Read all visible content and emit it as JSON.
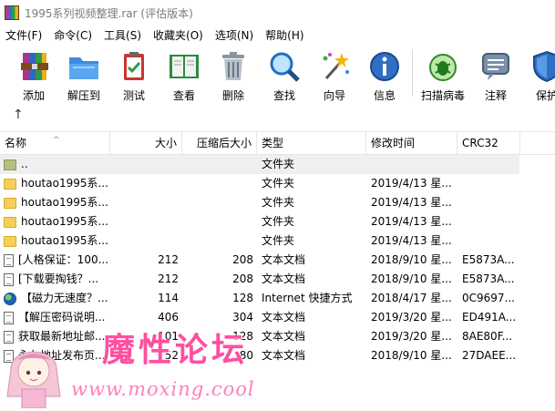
{
  "window": {
    "title": "1995系列视频整理.rar (评估版本)"
  },
  "menu": [
    "文件(F)",
    "命令(C)",
    "工具(S)",
    "收藏夹(O)",
    "选项(N)",
    "帮助(H)"
  ],
  "toolbar": [
    {
      "label": "添加",
      "icon": "add-archive-icon"
    },
    {
      "label": "解压到",
      "icon": "extract-folder-icon"
    },
    {
      "label": "测试",
      "icon": "test-clipboard-icon"
    },
    {
      "label": "查看",
      "icon": "view-book-icon"
    },
    {
      "label": "删除",
      "icon": "trash-icon"
    },
    {
      "label": "查找",
      "icon": "magnifier-icon"
    },
    {
      "label": "向导",
      "icon": "wizard-wand-icon"
    },
    {
      "label": "信息",
      "icon": "info-icon"
    },
    {
      "label": "扫描病毒",
      "icon": "virus-scan-icon"
    },
    {
      "label": "注释",
      "icon": "comment-icon"
    },
    {
      "label": "保护",
      "icon": "shield-icon"
    }
  ],
  "navbar": {
    "up_glyph": "↑"
  },
  "columns": {
    "name": "名称",
    "size": "大小",
    "packed": "压缩后大小",
    "type": "类型",
    "modified": "修改时间",
    "crc": "CRC32"
  },
  "rows": [
    {
      "icon": "folder-up",
      "name": "..",
      "size": "",
      "packed": "",
      "type": "文件夹",
      "modified": "",
      "crc": ""
    },
    {
      "icon": "folder",
      "name": "houtao1995系...",
      "size": "",
      "packed": "",
      "type": "文件夹",
      "modified": "2019/4/13 星...",
      "crc": ""
    },
    {
      "icon": "folder",
      "name": "houtao1995系...",
      "size": "",
      "packed": "",
      "type": "文件夹",
      "modified": "2019/4/13 星...",
      "crc": ""
    },
    {
      "icon": "folder",
      "name": "houtao1995系...",
      "size": "",
      "packed": "",
      "type": "文件夹",
      "modified": "2019/4/13 星...",
      "crc": ""
    },
    {
      "icon": "folder",
      "name": "houtao1995系...",
      "size": "",
      "packed": "",
      "type": "文件夹",
      "modified": "2019/4/13 星...",
      "crc": ""
    },
    {
      "icon": "doc",
      "name": "[人格保证：100...",
      "size": "212",
      "packed": "208",
      "type": "文本文档",
      "modified": "2018/9/10 星...",
      "crc": "E5873A..."
    },
    {
      "icon": "doc",
      "name": "[下载要掏钱？...",
      "size": "212",
      "packed": "208",
      "type": "文本文档",
      "modified": "2018/9/10 星...",
      "crc": "E5873A..."
    },
    {
      "icon": "globe",
      "name": "【磁力无速度？...",
      "size": "114",
      "packed": "128",
      "type": "Internet 快捷方式",
      "modified": "2018/4/17 星...",
      "crc": "0C9697..."
    },
    {
      "icon": "doc",
      "name": "【解压密码说明...",
      "size": "406",
      "packed": "304",
      "type": "文本文档",
      "modified": "2019/3/20 星...",
      "crc": "ED491A..."
    },
    {
      "icon": "doc",
      "name": "获取最新地址邮...",
      "size": "101",
      "packed": "128",
      "type": "文本文档",
      "modified": "2019/3/20 星...",
      "crc": "8AE80F..."
    },
    {
      "icon": "doc",
      "name": "永久地址发布页...",
      "size": "52",
      "packed": "80",
      "type": "文本文档",
      "modified": "2018/9/10 星...",
      "crc": "27DAEE..."
    }
  ],
  "watermark": {
    "cn": "魔性论坛",
    "url": "www.moxing.cool"
  }
}
